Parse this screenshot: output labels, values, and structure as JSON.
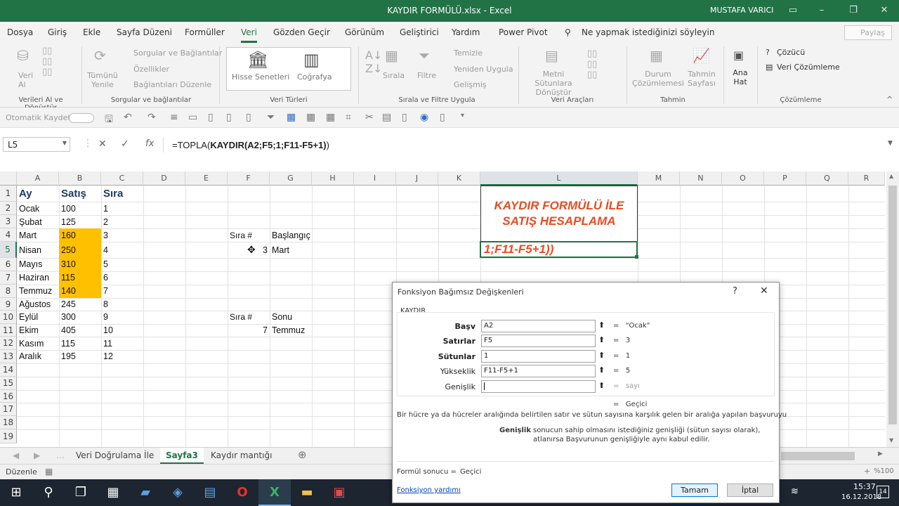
{
  "window": {
    "title": "KAYDIR FORMÜLÜ.xlsx  -  Excel",
    "user": "MUSTAFA VARICI"
  },
  "menu": {
    "tabs": [
      "Dosya",
      "Giriş",
      "Ekle",
      "Sayfa Düzeni",
      "Formüller",
      "Veri",
      "Gözden Geçir",
      "Görünüm",
      "Geliştirici",
      "Yardım",
      "Power Pivot"
    ],
    "tellme": "Ne yapmak istediğinizi söyleyin",
    "share": "Paylaş"
  },
  "ribbon": {
    "g1": {
      "btn": "Veri Al",
      "label": "Verileri Al ve Dönüştür"
    },
    "g2": {
      "refresh": "Tümünü Yenile",
      "items": [
        "Sorgular ve Bağlantılar",
        "Özellikler",
        "Bağlantıları Düzenle"
      ],
      "label": "Sorgular ve bağlantılar"
    },
    "g3": {
      "stocks": "Hisse Senetleri",
      "geo": "Coğrafya",
      "label": "Veri Türleri"
    },
    "g4": {
      "sort": "Sırala",
      "filter": "Filtre",
      "items": [
        "Temizle",
        "Yeniden Uygula",
        "Gelişmiş"
      ],
      "label": "Sırala ve Filtre Uygula"
    },
    "g5": {
      "textcol": "Metni Sütunlara Dönüştür",
      "label": "Veri Araçları"
    },
    "g6": {
      "whatif": "Durum Çözümlemesi",
      "forecast": "Tahmin Sayfası",
      "label": "Tahmin"
    },
    "g7": {
      "outline": "Ana Hat",
      "solver": "Çözücü",
      "analysis": "Veri Çözümleme",
      "label": "Çözümleme"
    }
  },
  "qat": {
    "autosave": "Otomatik Kaydet"
  },
  "formula_bar": {
    "namebox": "L5",
    "formula_prefix": "=TOPLA(",
    "formula_bold": "KAYDIR(A2;F5;1;F11-F5+1)",
    "formula_suffix": ")"
  },
  "columns": [
    "A",
    "B",
    "C",
    "D",
    "E",
    "F",
    "G",
    "H",
    "I",
    "J",
    "K",
    "L",
    "M",
    "N",
    "O",
    "P",
    "Q",
    "R"
  ],
  "rows": [
    "1",
    "2",
    "3",
    "4",
    "5",
    "6",
    "7",
    "8",
    "9",
    "10",
    "11",
    "12",
    "13",
    "14",
    "15",
    "16",
    "17",
    "18",
    "19"
  ],
  "headers": {
    "a": "Ay",
    "b": "Satış",
    "c": "Sıra"
  },
  "data": [
    {
      "ay": "Ocak",
      "satis": "100",
      "sira": "1"
    },
    {
      "ay": "Şubat",
      "satis": "125",
      "sira": "2"
    },
    {
      "ay": "Mart",
      "satis": "160",
      "sira": "3"
    },
    {
      "ay": "Nisan",
      "satis": "250",
      "sira": "4"
    },
    {
      "ay": "Mayıs",
      "satis": "310",
      "sira": "5"
    },
    {
      "ay": "Haziran",
      "satis": "115",
      "sira": "6"
    },
    {
      "ay": "Temmuz",
      "satis": "140",
      "sira": "7"
    },
    {
      "ay": "Ağustos",
      "satis": "245",
      "sira": "8"
    },
    {
      "ay": "Eylül",
      "satis": "300",
      "sira": "9"
    },
    {
      "ay": "Ekim",
      "satis": "405",
      "sira": "10"
    },
    {
      "ay": "Kasım",
      "satis": "115",
      "sira": "11"
    },
    {
      "ay": "Aralık",
      "satis": "195",
      "sira": "12"
    }
  ],
  "side": {
    "f4": "Sıra #",
    "g4": "Başlangıç",
    "f5": "3",
    "g5": "Mart",
    "f10": "Sıra #",
    "g10": "Sonu",
    "f11": "7",
    "g11": "Temmuz"
  },
  "banner": {
    "line1": "KAYDIR FORMÜLÜ İLE",
    "line2": "SATIŞ HESAPLAMA",
    "edit": "1;F11-F5+1))",
    "color": "#e84c22"
  },
  "sheets": {
    "tabs": [
      "Veri Doğrulama İle",
      "Sayfa3",
      "Kaydır mantığı"
    ],
    "active": "Sayfa3"
  },
  "status": {
    "mode": "Düzenle",
    "zoom": "%100"
  },
  "dialog": {
    "title": "Fonksiyon Bağımsız Değişkenleri",
    "help": "?",
    "fn": "KAYDIR",
    "args": [
      {
        "label": "Başv",
        "value": "A2",
        "result": "\"Ocak\""
      },
      {
        "label": "Satırlar",
        "value": "F5",
        "result": "3"
      },
      {
        "label": "Sütunlar",
        "value": "1",
        "result": "1"
      },
      {
        "label": "Yükseklik",
        "value": "F11-F5+1",
        "result": "5"
      },
      {
        "label": "Genişlik",
        "value": "",
        "result": "sayı"
      }
    ],
    "total": "Geçici",
    "description": "Bir hücre ya da hücreler aralığında belirtilen satır ve sütun sayısına karşılık gelen bir aralığa yapılan başvuruyu",
    "arg_name": "Genişlik",
    "arg_desc1": "sonucun sahip olmasını istediğiniz genişliği (sütun sayısı olarak),",
    "arg_desc2": "atlanırsa Başvurunun genişliğiyle aynı kabul edilir.",
    "result_label": "Formül sonucu =",
    "result_value": "Geçici",
    "help_link": "Fonksiyon yardımı",
    "ok": "Tamam",
    "cancel": "İptal"
  },
  "taskbar": {
    "time": "15:37",
    "date": "16.12.2018",
    "badge": "14"
  }
}
